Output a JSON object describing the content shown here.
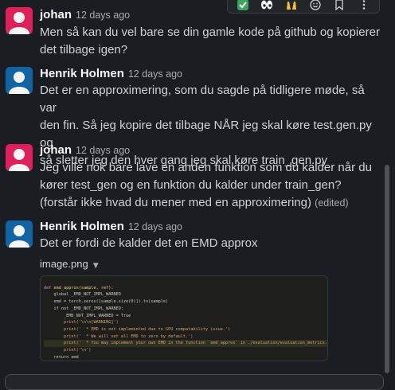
{
  "reaction_bar": {
    "items": [
      {
        "name": "check-emoji",
        "glyph": "✅"
      },
      {
        "name": "eyes-emoji",
        "glyph": "👀"
      },
      {
        "name": "raised-hands-emoji",
        "glyph": "🙌"
      },
      {
        "name": "add-reaction-icon",
        "glyph": "☺"
      },
      {
        "name": "bookmark-icon",
        "glyph": "⌑"
      },
      {
        "name": "more-actions-icon",
        "glyph": "⋮"
      }
    ]
  },
  "messages": [
    {
      "author": "johan",
      "time": "12 days ago",
      "avatar_color": "#e01e5a",
      "lines": [
        "Men så kan du vel bare se din gamle kode på github og kopierer",
        "det tilbage igen?"
      ]
    },
    {
      "author": "Henrik Holmen",
      "time": "12 days ago",
      "avatar_color": "#1164a3",
      "lines": [
        "Det er en approximering, som du sagde på tidligere møde, så var",
        "den fin. Så jeg kopire det tilbage NÅR jeg skal køre test.gen.py og",
        "så sletter jeg den hver gang jeg skal køre train_gen.py"
      ]
    },
    {
      "author": "johan",
      "time": "12 days ago",
      "avatar_color": "#e01e5a",
      "lines": [
        "Jeg ville nok bare lave en anden funktion som du kalder når du",
        "kører test_gen og en funktion du kalder under train_gen?",
        "(forstår ikke hvad du mener med en approximering)"
      ],
      "edited": "(edited)"
    },
    {
      "author": "Henrik Holmen",
      "time": "12 days ago",
      "avatar_color": "#1164a3",
      "lines": [
        "Det er fordi de kalder det en EMD approx"
      ],
      "attachment": {
        "filename": "image.png",
        "code": [
          "def emd_approx(sample, ref):",
          "    global _EMD_NOT_IMPL_WARNED",
          "    emd = torch.zeros([sample.size(0)]).to(sample)",
          "    if not _EMD_NOT_IMPL_WARNED:",
          "        _EMD_NOT_IMPL_WARNED = True",
          "        print('\\n\\n[WARNING]')",
          "        print('  * EMD is not implemented due to GPU compatability issue.')",
          "        print('  * We will set all EMD to zero by default.')",
          "        print('  * You may implement your own EMD in the function `emd_approx` in ./evaluation/evaluation_metrics.py')",
          "        print('\\n')",
          "    return emd"
        ]
      }
    }
  ]
}
